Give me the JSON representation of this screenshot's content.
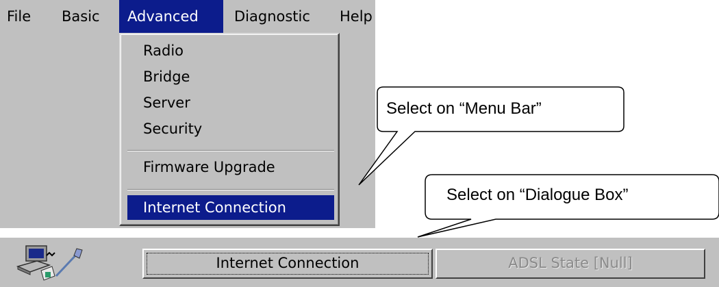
{
  "menubar": {
    "items": [
      "File",
      "Basic",
      "Advanced",
      "Diagnostic",
      "Help"
    ],
    "active": "Advanced"
  },
  "dropdown": {
    "items": [
      "Radio",
      "Bridge",
      "Server",
      "Security",
      "Firmware Upgrade",
      "Internet Connection"
    ],
    "highlighted": "Internet Connection"
  },
  "callouts": {
    "menu_bar": "Select on “Menu Bar”",
    "dialogue_box": "Select on “Dialogue Box”"
  },
  "toolbar": {
    "icon": "network-computer-icon",
    "buttons": [
      "Internet Connection",
      "ADSL State [Null]"
    ]
  },
  "colors": {
    "window_gray": "#c0c0c0",
    "highlight_navy": "#0c1c8c",
    "disabled_text": "#8a8a8a"
  }
}
